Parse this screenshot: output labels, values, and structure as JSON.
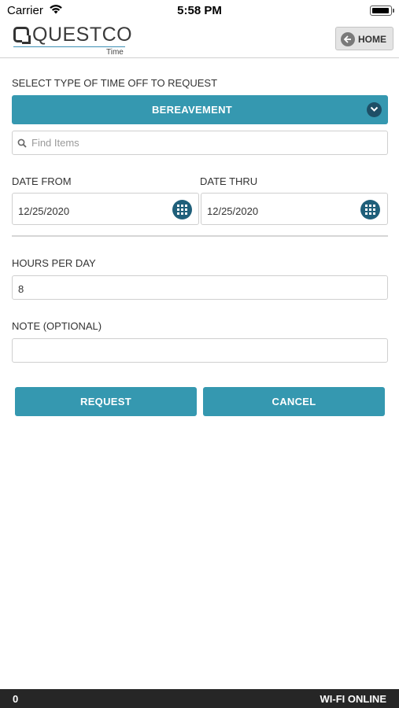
{
  "status_bar": {
    "carrier": "Carrier",
    "time": "5:58 PM",
    "wifi_icon": "wifi-icon",
    "battery_icon": "battery-icon"
  },
  "header": {
    "logo_text": "QUESTCO",
    "logo_subtext": "Time",
    "home_label": "HOME",
    "home_icon": "back-arrow-icon"
  },
  "form": {
    "type_label": "SELECT TYPE OF TIME OFF TO REQUEST",
    "type_selected": "BEREAVEMENT",
    "search_placeholder": "Find Items",
    "date_from_label": "DATE FROM",
    "date_from_value": "12/25/2020",
    "date_thru_label": "DATE THRU",
    "date_thru_value": "12/25/2020",
    "hours_label": "HOURS PER DAY",
    "hours_value": "8",
    "note_label": "NOTE (OPTIONAL)",
    "note_value": ""
  },
  "actions": {
    "request_label": "REQUEST",
    "cancel_label": "CANCEL"
  },
  "footer": {
    "count": "0",
    "connection_status": "WI-FI ONLINE"
  },
  "colors": {
    "accent": "#3598b0",
    "accent_dark": "#1f5f7a",
    "footer_bg": "#262626"
  }
}
